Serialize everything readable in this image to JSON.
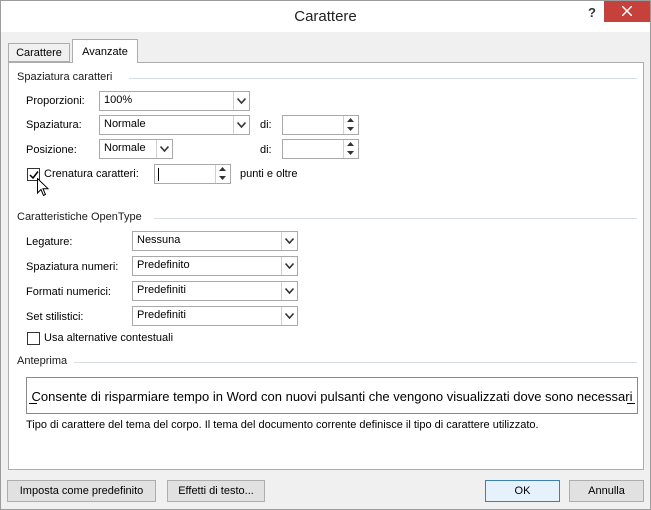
{
  "window": {
    "title": "Carattere",
    "help_symbol": "?",
    "close_symbol": "✕"
  },
  "tabs": [
    {
      "label": "Carattere",
      "selected": false
    },
    {
      "label": "Avanzate",
      "selected": true
    }
  ],
  "spacing_section": {
    "title": "Spaziatura caratteri",
    "proportions": {
      "label": "Proporzioni:",
      "value": "100%"
    },
    "spacing": {
      "label": "Spaziatura:",
      "value": "Normale",
      "by_label": "di:",
      "by_value": ""
    },
    "position": {
      "label": "Posizione:",
      "value": "Normale",
      "by_label": "di:",
      "by_value": ""
    },
    "kerning": {
      "label": "Crenatura caratteri:",
      "checked": true,
      "value": "",
      "suffix": "punti e oltre"
    }
  },
  "opentype_section": {
    "title": "Caratteristiche OpenType",
    "ligatures": {
      "label": "Legature:",
      "value": "Nessuna"
    },
    "number_spacing": {
      "label": "Spaziatura numeri:",
      "value": "Predefinito"
    },
    "number_forms": {
      "label": "Formati numerici:",
      "value": "Predefiniti"
    },
    "stylistic_sets": {
      "label": "Set stilistici:",
      "value": "Predefiniti"
    },
    "contextual_alternates": {
      "label": "Usa alternative contestuali",
      "checked": false
    }
  },
  "preview_section": {
    "title": "Anteprima",
    "sample_text": "Consente di risparmiare tempo in Word con nuovi pulsanti che vengono visualizzati dove sono necessari",
    "description": "Tipo di carattere del tema del corpo. Il tema del documento corrente definisce il tipo di carattere utilizzato."
  },
  "buttons": {
    "set_default": "Imposta come predefinito",
    "text_effects": "Effetti di testo...",
    "ok": "OK",
    "cancel": "Annulla"
  },
  "colors": {
    "close_button": "#c7413c",
    "default_button_border": "#3c7fb1"
  }
}
